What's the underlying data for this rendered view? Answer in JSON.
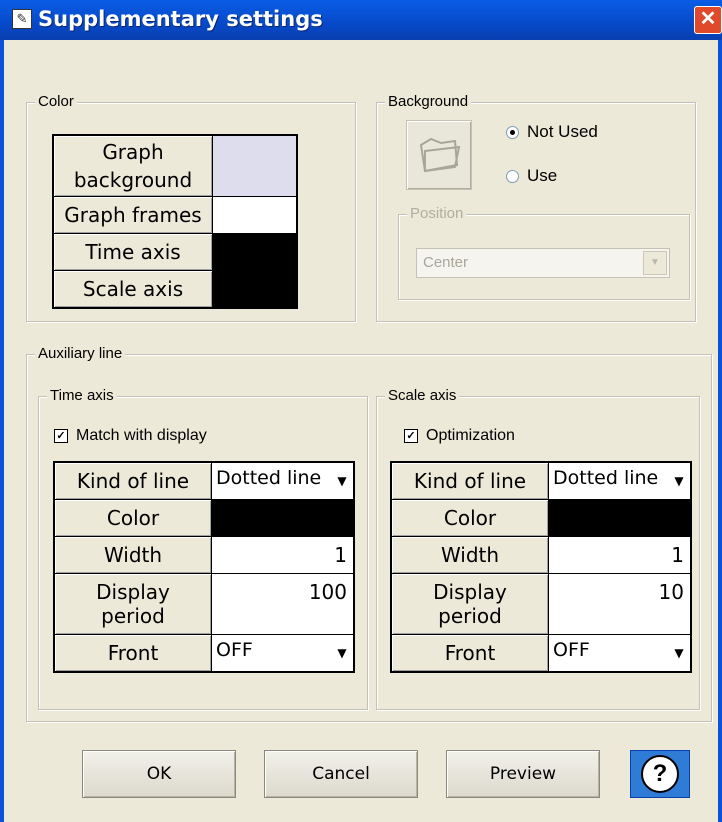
{
  "window": {
    "title": "Supplementary settings"
  },
  "color_group": {
    "label": "Color",
    "rows": [
      {
        "label": "Graph background",
        "swatch": "#DDDDEE"
      },
      {
        "label": "Graph frames",
        "swatch": "#FFFFFF"
      },
      {
        "label": "Time axis",
        "swatch": "#000000"
      },
      {
        "label": "Scale axis",
        "swatch": "#000000"
      }
    ]
  },
  "background_group": {
    "label": "Background",
    "option_not_used": "Not Used",
    "option_use": "Use",
    "selected": "Not Used",
    "position": {
      "label": "Position",
      "value": "Center"
    }
  },
  "auxiliary_line": {
    "label": "Auxiliary line",
    "time_axis": {
      "label": "Time axis",
      "checkbox_label": "Match with display",
      "checked": true,
      "kind_of_line_label": "Kind of line",
      "kind_of_line_value": "Dotted line",
      "color_label": "Color",
      "color_value": "#000000",
      "width_label": "Width",
      "width_value": "1",
      "display_period_label_1": "Display",
      "display_period_label_2": "period",
      "display_period_value": "100",
      "front_label": "Front",
      "front_value": "OFF"
    },
    "scale_axis": {
      "label": "Scale axis",
      "checkbox_label": "Optimization",
      "checked": true,
      "kind_of_line_label": "Kind of line",
      "kind_of_line_value": "Dotted line",
      "color_label": "Color",
      "color_value": "#000000",
      "width_label": "Width",
      "width_value": "1",
      "display_period_label_1": "Display",
      "display_period_label_2": "period",
      "display_period_value": "10",
      "front_label": "Front",
      "front_value": "OFF"
    }
  },
  "buttons": {
    "ok": "OK",
    "cancel": "Cancel",
    "preview": "Preview",
    "help": "?"
  }
}
